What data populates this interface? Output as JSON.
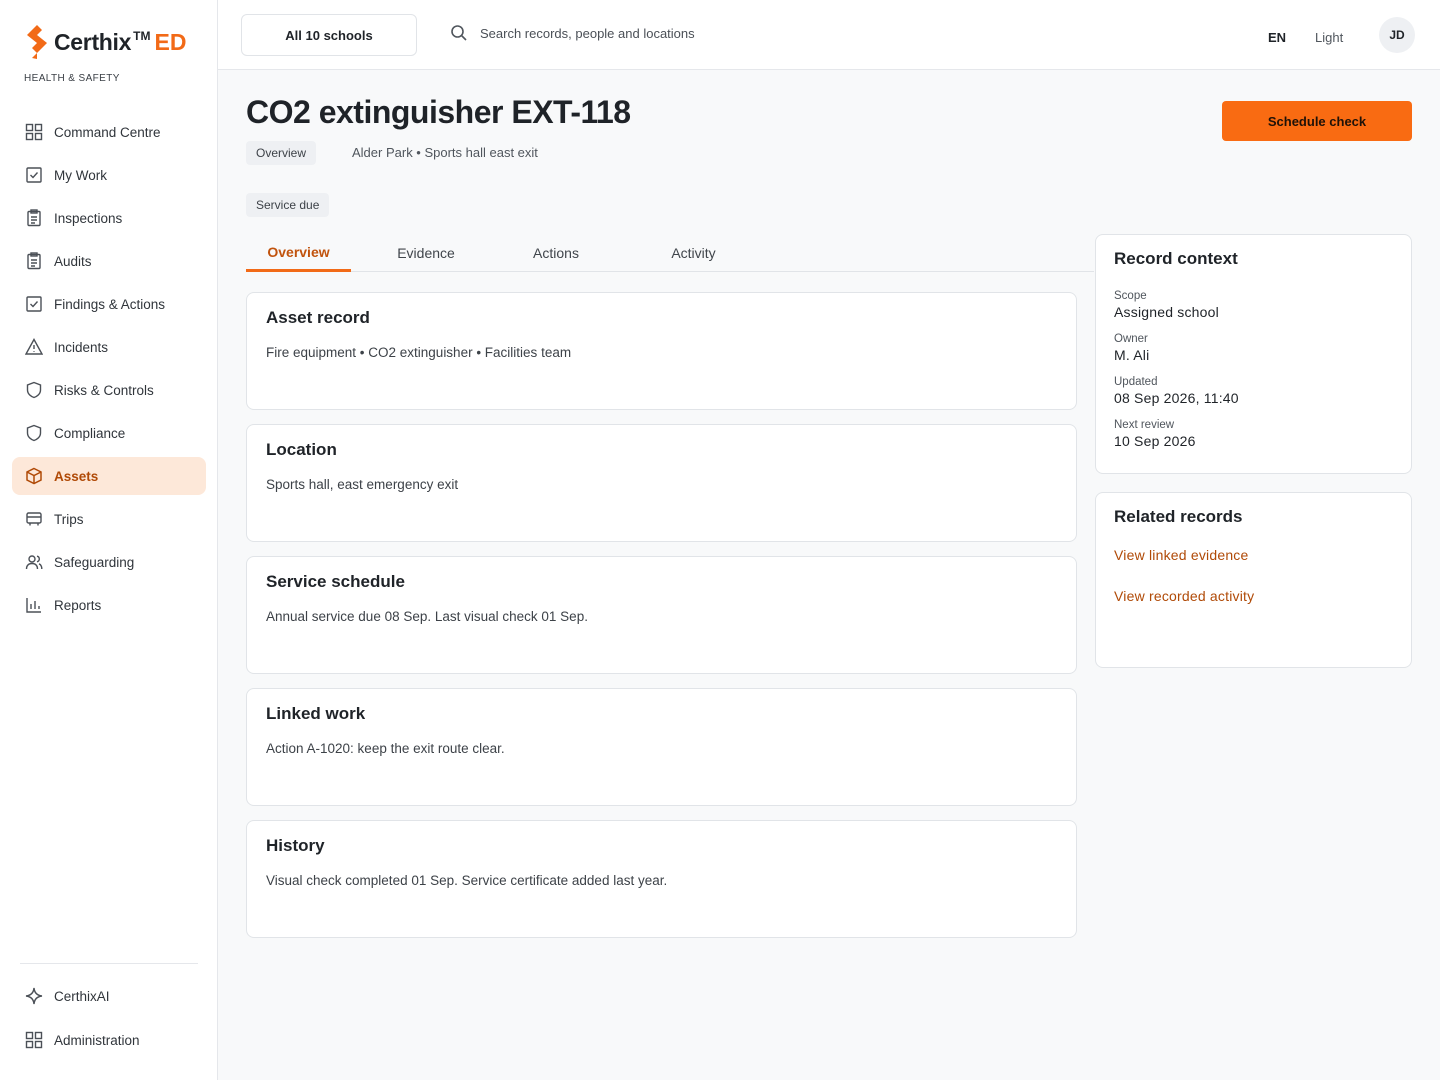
{
  "brand": {
    "name": "Certhix",
    "tm": "TM",
    "suffix": "ED",
    "tagline": "HEALTH & SAFETY",
    "accent": "#f26a17"
  },
  "sidebar": {
    "items": [
      {
        "label": "Command Centre",
        "icon": "grid-icon"
      },
      {
        "label": "My Work",
        "icon": "checkbox-icon"
      },
      {
        "label": "Inspections",
        "icon": "clipboard-icon"
      },
      {
        "label": "Audits",
        "icon": "clipboard-icon"
      },
      {
        "label": "Findings & Actions",
        "icon": "checkbox-icon"
      },
      {
        "label": "Incidents",
        "icon": "warning-icon"
      },
      {
        "label": "Risks & Controls",
        "icon": "shield-icon"
      },
      {
        "label": "Compliance",
        "icon": "shield-icon"
      },
      {
        "label": "Assets",
        "icon": "box-icon",
        "active": true
      },
      {
        "label": "Trips",
        "icon": "bus-icon"
      },
      {
        "label": "Safeguarding",
        "icon": "users-icon"
      },
      {
        "label": "Reports",
        "icon": "bar-chart-icon"
      }
    ],
    "bottom": [
      {
        "label": "CerthixAI",
        "icon": "sparkle-icon"
      },
      {
        "label": "Administration",
        "icon": "grid-icon"
      }
    ]
  },
  "topbar": {
    "school_select": "All 10 schools",
    "search_placeholder": "Search records, people and locations",
    "lang": "EN",
    "theme": "Light",
    "avatar": "JD"
  },
  "header": {
    "title": "CO2 extinguisher EXT-118",
    "crumb_chip": "Overview",
    "location": "Alder Park • Sports hall east exit",
    "status": "Service due",
    "primary_action": "Schedule check"
  },
  "tabs": [
    "Overview",
    "Evidence",
    "Actions",
    "Activity"
  ],
  "cards": [
    {
      "title": "Asset record",
      "body": "Fire equipment • CO2 extinguisher • Facilities team"
    },
    {
      "title": "Location",
      "body": "Sports hall, east emergency exit"
    },
    {
      "title": "Service schedule",
      "body": "Annual service due 08 Sep. Last visual check 01 Sep."
    },
    {
      "title": "Linked work",
      "body": "Action A-1020: keep the exit route clear."
    },
    {
      "title": "History",
      "body": "Visual check completed 01 Sep. Service certificate added last year."
    }
  ],
  "context": {
    "title": "Record context",
    "fields": [
      {
        "label": "Scope",
        "value": "Assigned school"
      },
      {
        "label": "Owner",
        "value": "M. Ali"
      },
      {
        "label": "Updated",
        "value": "08 Sep 2026, 11:40"
      },
      {
        "label": "Next review",
        "value": "10 Sep 2026"
      }
    ]
  },
  "related": {
    "title": "Related records",
    "links": [
      "View linked evidence",
      "View recorded activity"
    ]
  }
}
